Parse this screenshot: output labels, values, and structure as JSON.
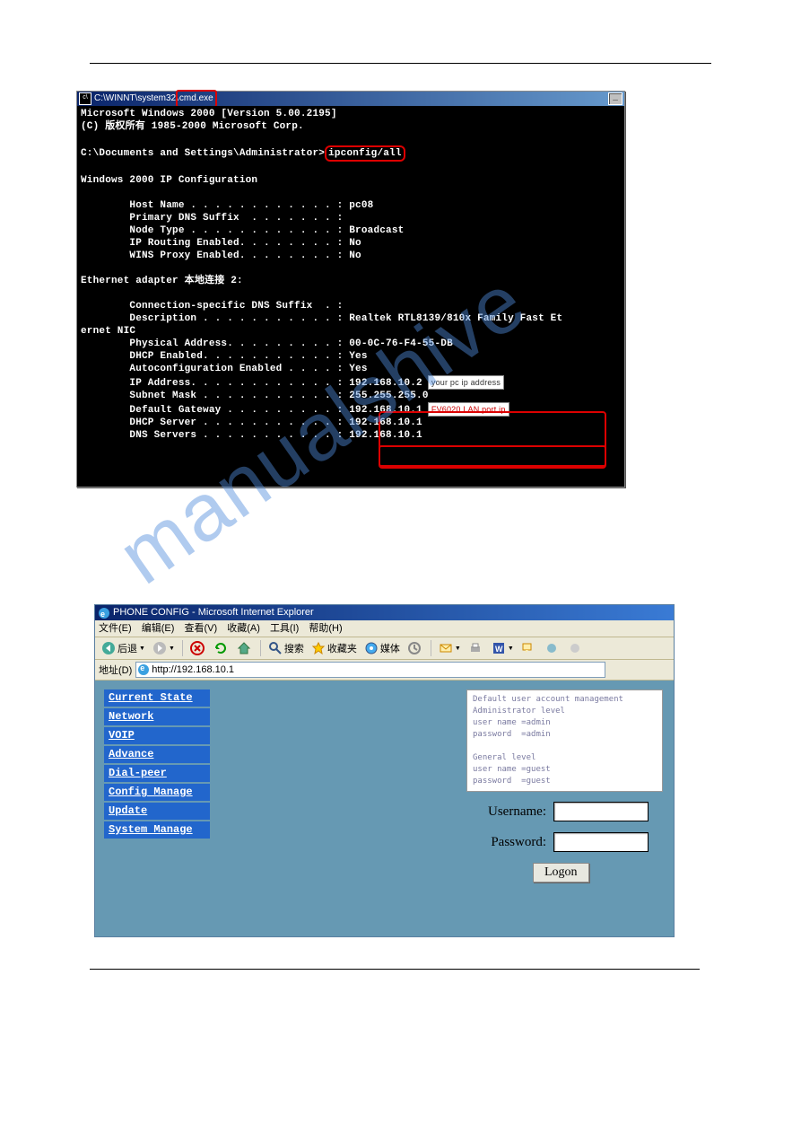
{
  "cmd": {
    "title_prefix": "C:\\WINNT\\system32\\",
    "title_exe": "cmd.exe",
    "line1": "Microsoft Windows 2000 [Version 5.00.2195]",
    "line2": "(C) 版权所有 1985-2000 Microsoft Corp.",
    "prompt_prefix": "C:\\Documents and Settings\\Administrator>",
    "prompt_cmd": "ipconfig/all",
    "header": "Windows 2000 IP Configuration",
    "host_name": "        Host Name . . . . . . . . . . . . : pc08",
    "primary_dns": "        Primary DNS Suffix  . . . . . . . :",
    "node_type": "        Node Type . . . . . . . . . . . . : Broadcast",
    "ip_routing": "        IP Routing Enabled. . . . . . . . : No",
    "wins_proxy": "        WINS Proxy Enabled. . . . . . . . : No",
    "adapter_header": "Ethernet adapter 本地连接 2:",
    "conn_suffix": "        Connection-specific DNS Suffix  . :",
    "description": "        Description . . . . . . . . . . . : Realtek RTL8139/810x Family Fast Et",
    "nic_tail": "ernet NIC",
    "phys_addr": "        Physical Address. . . . . . . . . : 00-0C-76-F4-55-DB",
    "dhcp_enabled": "        DHCP Enabled. . . . . . . . . . . : Yes",
    "auto_ip_lbl": "        Autoconfiguration Enabled . . . . : ",
    "auto_ip_val": "Yes",
    "ip_addr_lbl": "        IP Address. . . . . . . . . . . . : ",
    "ip_addr_val": "192.168.10.2",
    "ip_addr_annot": "your pc ip address",
    "subnet_lbl": "        Subnet Mask . . . . . . . . . . . : ",
    "subnet_val": "255.255.255.0",
    "gateway_lbl": "        Default Gateway . . . . . . . . . : ",
    "gateway_val": "192.168.10.1",
    "gateway_annot": "FV6020 LAN port ip",
    "dhcp_server": "        DHCP Server . . . . . . . . . . . : 192.168.10.1",
    "dns_servers": "        DNS Servers . . . . . . . . . . . : 192.168.10.1"
  },
  "ie": {
    "title": "PHONE CONFIG - Microsoft Internet Explorer",
    "menu": [
      "文件(E)",
      "编辑(E)",
      "查看(V)",
      "收藏(A)",
      "工具(I)",
      "帮助(H)"
    ],
    "back": "后退",
    "search": "搜索",
    "fav": "收藏夹",
    "media": "媒体",
    "addr_label": "地址(D)",
    "url": "http://192.168.10.1",
    "nav": [
      "Current State",
      "Network",
      "VOIP",
      "Advance",
      "Dial-peer",
      "Config Manage",
      "Update",
      "System Manage"
    ],
    "info": "Default user account management\nAdministrator level\nuser name =admin\npassword  =admin\n\nGeneral level\nuser name =guest\npassword  =guest",
    "username_label": "Username:",
    "password_label": "Password:",
    "logon": "Logon"
  }
}
